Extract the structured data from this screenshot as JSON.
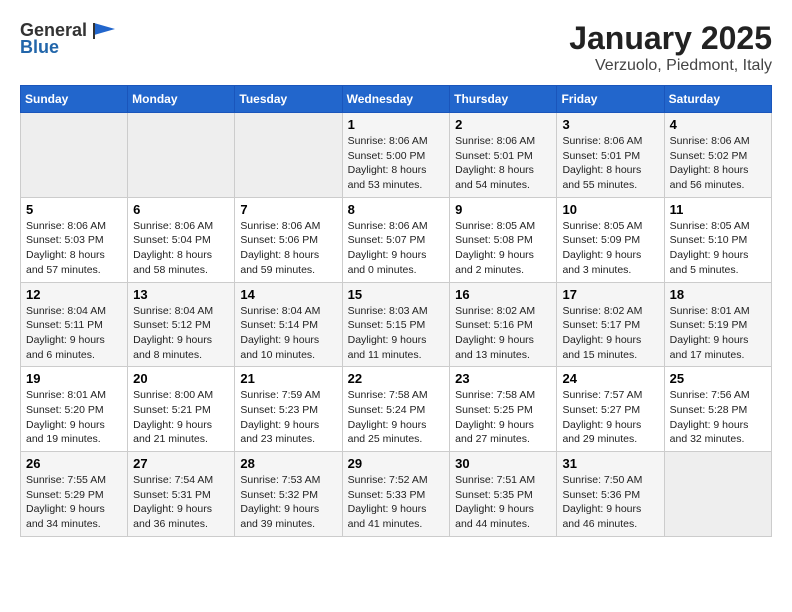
{
  "header": {
    "logo_general": "General",
    "logo_blue": "Blue",
    "title": "January 2025",
    "subtitle": "Verzuolo, Piedmont, Italy"
  },
  "days_of_week": [
    "Sunday",
    "Monday",
    "Tuesday",
    "Wednesday",
    "Thursday",
    "Friday",
    "Saturday"
  ],
  "weeks": [
    [
      {
        "day": "",
        "content": ""
      },
      {
        "day": "",
        "content": ""
      },
      {
        "day": "",
        "content": ""
      },
      {
        "day": "1",
        "content": "Sunrise: 8:06 AM\nSunset: 5:00 PM\nDaylight: 8 hours and 53 minutes."
      },
      {
        "day": "2",
        "content": "Sunrise: 8:06 AM\nSunset: 5:01 PM\nDaylight: 8 hours and 54 minutes."
      },
      {
        "day": "3",
        "content": "Sunrise: 8:06 AM\nSunset: 5:01 PM\nDaylight: 8 hours and 55 minutes."
      },
      {
        "day": "4",
        "content": "Sunrise: 8:06 AM\nSunset: 5:02 PM\nDaylight: 8 hours and 56 minutes."
      }
    ],
    [
      {
        "day": "5",
        "content": "Sunrise: 8:06 AM\nSunset: 5:03 PM\nDaylight: 8 hours and 57 minutes."
      },
      {
        "day": "6",
        "content": "Sunrise: 8:06 AM\nSunset: 5:04 PM\nDaylight: 8 hours and 58 minutes."
      },
      {
        "day": "7",
        "content": "Sunrise: 8:06 AM\nSunset: 5:06 PM\nDaylight: 8 hours and 59 minutes."
      },
      {
        "day": "8",
        "content": "Sunrise: 8:06 AM\nSunset: 5:07 PM\nDaylight: 9 hours and 0 minutes."
      },
      {
        "day": "9",
        "content": "Sunrise: 8:05 AM\nSunset: 5:08 PM\nDaylight: 9 hours and 2 minutes."
      },
      {
        "day": "10",
        "content": "Sunrise: 8:05 AM\nSunset: 5:09 PM\nDaylight: 9 hours and 3 minutes."
      },
      {
        "day": "11",
        "content": "Sunrise: 8:05 AM\nSunset: 5:10 PM\nDaylight: 9 hours and 5 minutes."
      }
    ],
    [
      {
        "day": "12",
        "content": "Sunrise: 8:04 AM\nSunset: 5:11 PM\nDaylight: 9 hours and 6 minutes."
      },
      {
        "day": "13",
        "content": "Sunrise: 8:04 AM\nSunset: 5:12 PM\nDaylight: 9 hours and 8 minutes."
      },
      {
        "day": "14",
        "content": "Sunrise: 8:04 AM\nSunset: 5:14 PM\nDaylight: 9 hours and 10 minutes."
      },
      {
        "day": "15",
        "content": "Sunrise: 8:03 AM\nSunset: 5:15 PM\nDaylight: 9 hours and 11 minutes."
      },
      {
        "day": "16",
        "content": "Sunrise: 8:02 AM\nSunset: 5:16 PM\nDaylight: 9 hours and 13 minutes."
      },
      {
        "day": "17",
        "content": "Sunrise: 8:02 AM\nSunset: 5:17 PM\nDaylight: 9 hours and 15 minutes."
      },
      {
        "day": "18",
        "content": "Sunrise: 8:01 AM\nSunset: 5:19 PM\nDaylight: 9 hours and 17 minutes."
      }
    ],
    [
      {
        "day": "19",
        "content": "Sunrise: 8:01 AM\nSunset: 5:20 PM\nDaylight: 9 hours and 19 minutes."
      },
      {
        "day": "20",
        "content": "Sunrise: 8:00 AM\nSunset: 5:21 PM\nDaylight: 9 hours and 21 minutes."
      },
      {
        "day": "21",
        "content": "Sunrise: 7:59 AM\nSunset: 5:23 PM\nDaylight: 9 hours and 23 minutes."
      },
      {
        "day": "22",
        "content": "Sunrise: 7:58 AM\nSunset: 5:24 PM\nDaylight: 9 hours and 25 minutes."
      },
      {
        "day": "23",
        "content": "Sunrise: 7:58 AM\nSunset: 5:25 PM\nDaylight: 9 hours and 27 minutes."
      },
      {
        "day": "24",
        "content": "Sunrise: 7:57 AM\nSunset: 5:27 PM\nDaylight: 9 hours and 29 minutes."
      },
      {
        "day": "25",
        "content": "Sunrise: 7:56 AM\nSunset: 5:28 PM\nDaylight: 9 hours and 32 minutes."
      }
    ],
    [
      {
        "day": "26",
        "content": "Sunrise: 7:55 AM\nSunset: 5:29 PM\nDaylight: 9 hours and 34 minutes."
      },
      {
        "day": "27",
        "content": "Sunrise: 7:54 AM\nSunset: 5:31 PM\nDaylight: 9 hours and 36 minutes."
      },
      {
        "day": "28",
        "content": "Sunrise: 7:53 AM\nSunset: 5:32 PM\nDaylight: 9 hours and 39 minutes."
      },
      {
        "day": "29",
        "content": "Sunrise: 7:52 AM\nSunset: 5:33 PM\nDaylight: 9 hours and 41 minutes."
      },
      {
        "day": "30",
        "content": "Sunrise: 7:51 AM\nSunset: 5:35 PM\nDaylight: 9 hours and 44 minutes."
      },
      {
        "day": "31",
        "content": "Sunrise: 7:50 AM\nSunset: 5:36 PM\nDaylight: 9 hours and 46 minutes."
      },
      {
        "day": "",
        "content": ""
      }
    ]
  ]
}
